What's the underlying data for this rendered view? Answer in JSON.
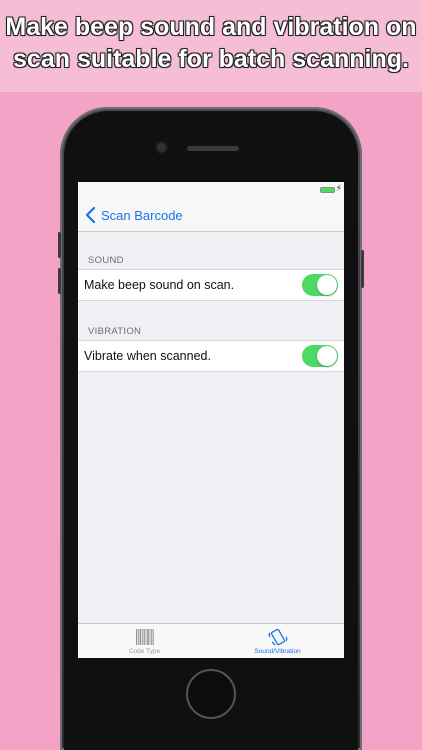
{
  "banner": {
    "line1": "Make beep sound and vibration on",
    "line2": "scan suitable for batch scanning."
  },
  "nav": {
    "back_label": "Scan Barcode"
  },
  "sections": [
    {
      "header": "SOUND",
      "row_label": "Make beep sound on scan.",
      "toggle_on": true
    },
    {
      "header": "VIBRATION",
      "row_label": "Vibrate when scanned.",
      "toggle_on": true
    }
  ],
  "tabbar": {
    "tabs": [
      {
        "label": "Code Type",
        "icon": "barcode-icon",
        "active": false
      },
      {
        "label": "Sound/Vibration",
        "icon": "vibration-icon",
        "active": true
      }
    ]
  },
  "colors": {
    "background": "#f2a3c6",
    "accent": "#1a73e8",
    "toggle_on": "#4cd964"
  }
}
